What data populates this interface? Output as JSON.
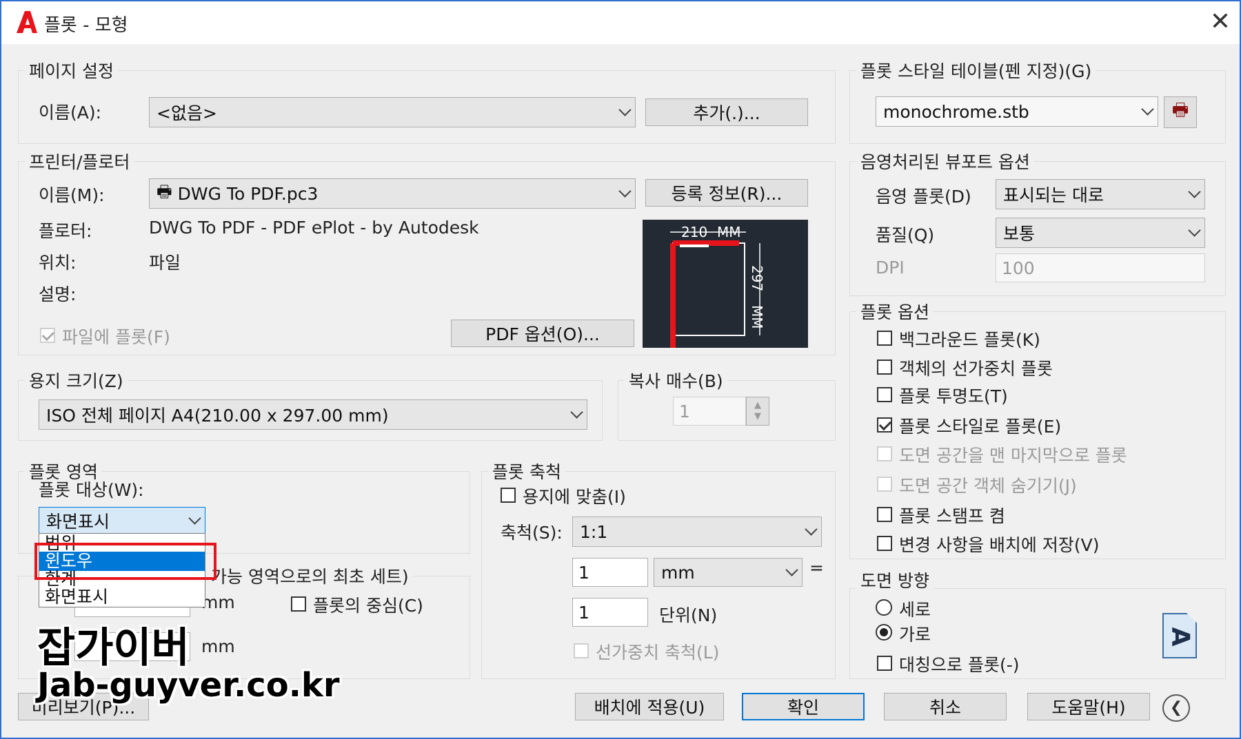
{
  "window": {
    "title": "플롯 - 모형"
  },
  "page_setup": {
    "group": "페이지 설정",
    "name_label": "이름(A):",
    "name_value": "<없음>",
    "add_button": "추가(.)..."
  },
  "printer": {
    "group": "프린터/플로터",
    "name_label": "이름(M):",
    "name_value": "DWG To PDF.pc3",
    "properties_button": "등록 정보(R)...",
    "plotter_label": "플로터:",
    "plotter_value": "DWG To PDF - PDF ePlot - by Autodesk",
    "where_label": "위치:",
    "where_value": "파일",
    "desc_label": "설명:",
    "plot_to_file": "파일에 플롯(F)",
    "pdf_options_button": "PDF 옵션(O)...",
    "preview_width": "210",
    "preview_height": "297",
    "preview_unit": "MM"
  },
  "paper": {
    "group": "용지 크기(Z)",
    "value": "ISO 전체 페이지 A4(210.00 x 297.00 mm)"
  },
  "copies": {
    "group": "복사 매수(B)",
    "value": "1"
  },
  "plot_area": {
    "group": "플롯 영역",
    "what_label": "플롯 대상(W):",
    "what_value": "화면표시",
    "options": [
      "범위",
      "윈도우",
      "한계",
      "화면표시"
    ],
    "selected_option": "윈도우"
  },
  "offset": {
    "group_suffix": "가능 영역으로의 최초 세트)",
    "unit1": "mm",
    "unit2": "mm",
    "center": "플롯의 중심(C)"
  },
  "scale": {
    "group": "플롯 축척",
    "fit": "용지에 맞춤(I)",
    "scale_label": "축척(S):",
    "scale_value": "1:1",
    "val1": "1",
    "unit_value": "mm",
    "equals": "=",
    "val2": "1",
    "units_label": "단위(N)",
    "lineweights": "선가중치 축척(L)"
  },
  "style_table": {
    "group": "플롯 스타일 테이블(펜 지정)(G)",
    "value": "monochrome.stb"
  },
  "shaded": {
    "group": "음영처리된 뷰포트 옵션",
    "shade_label": "음영 플롯(D)",
    "shade_value": "표시되는 대로",
    "quality_label": "품질(Q)",
    "quality_value": "보통",
    "dpi_label": "DPI",
    "dpi_value": "100"
  },
  "plot_options": {
    "group": "플롯 옵션",
    "items": [
      {
        "label": "백그라운드 플롯(K)",
        "checked": false,
        "enabled": true
      },
      {
        "label": "객체의 선가중치 플롯",
        "checked": false,
        "enabled": true
      },
      {
        "label": "플롯 투명도(T)",
        "checked": false,
        "enabled": true
      },
      {
        "label": "플롯 스타일로 플롯(E)",
        "checked": true,
        "enabled": true
      },
      {
        "label": "도면 공간을 맨 마지막으로 플롯",
        "checked": false,
        "enabled": false
      },
      {
        "label": "도면 공간 객체 숨기기(J)",
        "checked": false,
        "enabled": false
      },
      {
        "label": "플롯 스탬프 켬",
        "checked": false,
        "enabled": true
      },
      {
        "label": "변경 사항을 배치에 저장(V)",
        "checked": false,
        "enabled": true
      }
    ]
  },
  "orientation": {
    "group": "도면 방향",
    "portrait": "세로",
    "landscape": "가로",
    "upside_down": "대칭으로 플롯(-)",
    "icon_letter": "A"
  },
  "footer": {
    "preview": "미리보기(P)...",
    "apply": "배치에 적용(U)",
    "ok": "확인",
    "cancel": "취소",
    "help": "도움말(H)"
  },
  "watermark": {
    "line1": "잡가이버",
    "line2": "Jab-guyver.co.kr"
  },
  "colors": {
    "accent": "#0078d7",
    "highlight_box": "#e8141b",
    "title_icon": "#e8141b"
  }
}
